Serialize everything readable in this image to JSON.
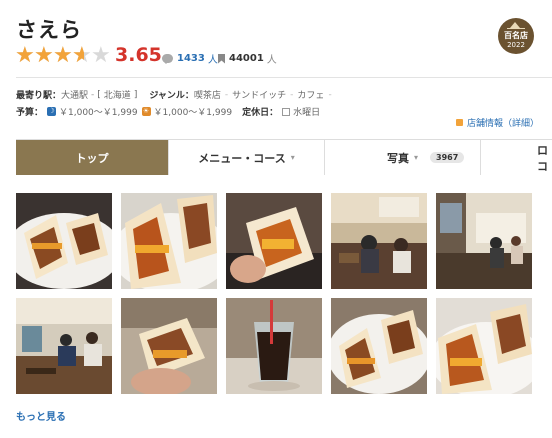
{
  "restaurant": {
    "name": "さえら",
    "rating": "3.65",
    "rating_value": 3.65,
    "review_count": "1433",
    "review_unit": "人",
    "bookmark_count": "44001",
    "bookmark_unit": "人",
    "badge": {
      "text": "百名店",
      "year": "2022"
    }
  },
  "info": {
    "station_label": "最寄り駅：",
    "station": "大通駅",
    "region_open": "[",
    "region": "北海道",
    "region_close": "]",
    "genre_label": "ジャンル：",
    "genres": [
      "喫茶店",
      "サンドイッチ",
      "カフェ"
    ],
    "budget_label": "予算：",
    "dinner_budget": "￥1,000～￥1,999",
    "lunch_budget": "￥1,000～￥1,999",
    "closed_label": "定休日：",
    "closed": "水曜日",
    "detail_link": "店舗情報（詳細）"
  },
  "tabs": [
    {
      "label": "トップ",
      "active": true
    },
    {
      "label": "メニュー・コース"
    },
    {
      "label": "写真",
      "count": "3967"
    },
    {
      "label": "ロコ"
    }
  ],
  "photos": [
    {
      "name": "sandwich-plate-photo"
    },
    {
      "name": "sandwich-cutlet-photo"
    },
    {
      "name": "sandwich-held-photo"
    },
    {
      "name": "cafe-interior-photo"
    },
    {
      "name": "cafe-counter-photo"
    },
    {
      "name": "cafe-seating-photo"
    },
    {
      "name": "sandwich-hand-photo"
    },
    {
      "name": "iced-coffee-photo"
    },
    {
      "name": "sandwich-pair-photo"
    },
    {
      "name": "sandwich-closeup-photo"
    }
  ],
  "more_link": "もっと見る",
  "colors": {
    "accent": "#8a7750",
    "score": "#d4342b",
    "star": "#f2a33a",
    "link": "#2a6fb3"
  }
}
